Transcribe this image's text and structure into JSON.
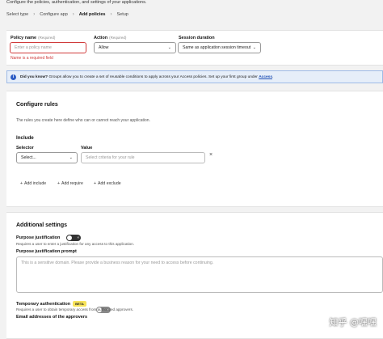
{
  "header": {
    "description": "Configure the policies, authentication, and settings of your applications.",
    "breadcrumbs": [
      {
        "label": "Select type"
      },
      {
        "label": "Configure app"
      },
      {
        "label": "Add policies"
      },
      {
        "label": "Setup"
      }
    ]
  },
  "policy": {
    "name_label": "Policy name",
    "name_required": "(Required)",
    "name_placeholder": "Enter a policy name",
    "name_error": "Name is a required field",
    "action_label": "Action",
    "action_required": "(Required)",
    "action_value": "Allow",
    "session_label": "Session duration",
    "session_value": "Same as application session timeout"
  },
  "banner": {
    "icon": "info-icon",
    "prefix": "Did you know?",
    "text": "Groups allow you to create a set of reusable conditions to apply across your Access policies. Set up your first group under",
    "link": "Access",
    "suffix": "."
  },
  "rules": {
    "title": "Configure rules",
    "description": "The rules you create here define who can or cannot reach your application.",
    "include_title": "Include",
    "selector_label": "Selector",
    "selector_value": "Select...",
    "value_label": "Value",
    "value_placeholder": "Select criteria for your rule",
    "remove_glyph": "×",
    "add_include": "Add include",
    "add_require": "Add require",
    "add_exclude": "Add exclude"
  },
  "additional": {
    "title": "Additional settings",
    "purpose_label": "Purpose justification",
    "purpose_desc": "Requires a user to enter a justification for any access to this application.",
    "prompt_label": "Purpose justification prompt",
    "prompt_placeholder": "This is a sensitive domain. Please provide a business reason for your need to access before continuing.",
    "temp_label": "Temporary authentication",
    "temp_badge": "BETA",
    "temp_desc": "Requires a user to obtain temporary access from authorized approvers.",
    "approvers_label": "Email addresses of the approvers"
  },
  "watermark": "知乎 @嘿嘿"
}
